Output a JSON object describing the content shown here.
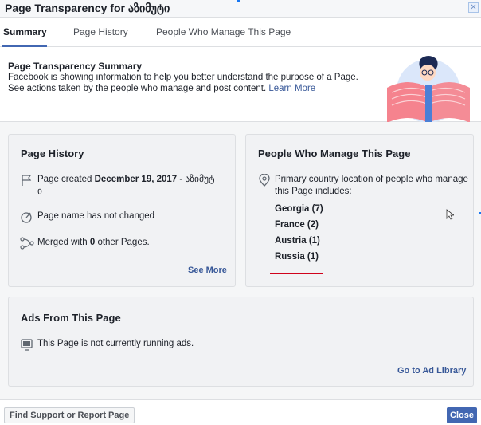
{
  "header": {
    "title": "Page Transparency for აზიმუტი",
    "close_glyph": "✕"
  },
  "tabs": [
    {
      "label": "Summary"
    },
    {
      "label": "Page History"
    },
    {
      "label": "People Who Manage This Page"
    }
  ],
  "intro": {
    "title": "Page Transparency Summary",
    "description": "Facebook is showing information to help you better understand the purpose of a Page. See actions taken by the people who manage and post content.",
    "learn_more": "Learn More"
  },
  "page_history": {
    "title": "Page History",
    "created_prefix": "Page created ",
    "created_date": "December 19, 2017 - ",
    "created_name_line1": "აზიმუტ",
    "created_name_line2": "ი",
    "name_status": "Page name has not changed",
    "merged_prefix": "Merged with ",
    "merged_count": "0",
    "merged_suffix": " other Pages.",
    "see_more": "See More",
    "icons": [
      "flag-icon",
      "edit-clock-icon",
      "merge-icon"
    ]
  },
  "people": {
    "title": "People Who Manage This Page",
    "location_text_line1": "Primary country location of people who manage",
    "location_text_line2": "this Page includes:",
    "countries": [
      {
        "label": "Georgia (7)"
      },
      {
        "label": "France (2)"
      },
      {
        "label": "Austria (1)"
      },
      {
        "label": "Russia (1)"
      }
    ],
    "highlight_color": "#d0021b",
    "icon": "location-pin-icon"
  },
  "ads": {
    "title": "Ads From This Page",
    "status": "This Page is not currently running ads.",
    "ad_library_link": "Go to Ad Library",
    "icon": "monitor-icon"
  },
  "footer": {
    "report_button": "Find Support or Report Page",
    "close_button": "Close"
  },
  "colors": {
    "accent": "#4267b2",
    "link": "#385898"
  }
}
